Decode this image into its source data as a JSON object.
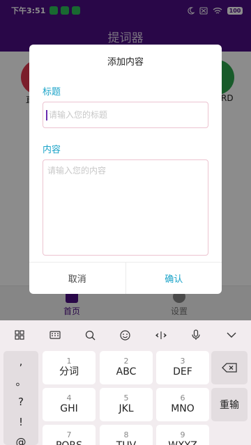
{
  "status_bar": {
    "time": "下午3:51",
    "battery": "100"
  },
  "app_bar": {
    "title": "提词器"
  },
  "background": {
    "left_text": "直",
    "right_text": "RD"
  },
  "bottom_nav": {
    "home_label": "首页",
    "settings_label": "设置"
  },
  "dialog": {
    "title": "添加内容",
    "title_label": "标题",
    "title_placeholder": "请输入您的标题",
    "content_label": "内容",
    "content_placeholder": "请输入您的内容",
    "cancel_label": "取消",
    "confirm_label": "确认"
  },
  "keyboard": {
    "symbols": [
      ",",
      "。",
      "?",
      "!",
      "@"
    ],
    "keys": [
      {
        "num": "1",
        "letters": "分词"
      },
      {
        "num": "2",
        "letters": "ABC"
      },
      {
        "num": "3",
        "letters": "DEF"
      },
      {
        "num": "4",
        "letters": "GHI"
      },
      {
        "num": "5",
        "letters": "JKL"
      },
      {
        "num": "6",
        "letters": "MNO"
      },
      {
        "num": "7",
        "letters": "PQRS"
      },
      {
        "num": "8",
        "letters": "TUV"
      },
      {
        "num": "9",
        "letters": "WXYZ"
      }
    ],
    "backspace_icon": "backspace-icon",
    "reenter_label": "重输"
  },
  "colors": {
    "primary": "#4b0d84",
    "accent": "#1aa3c8",
    "input_border": "#ecc3d0"
  }
}
